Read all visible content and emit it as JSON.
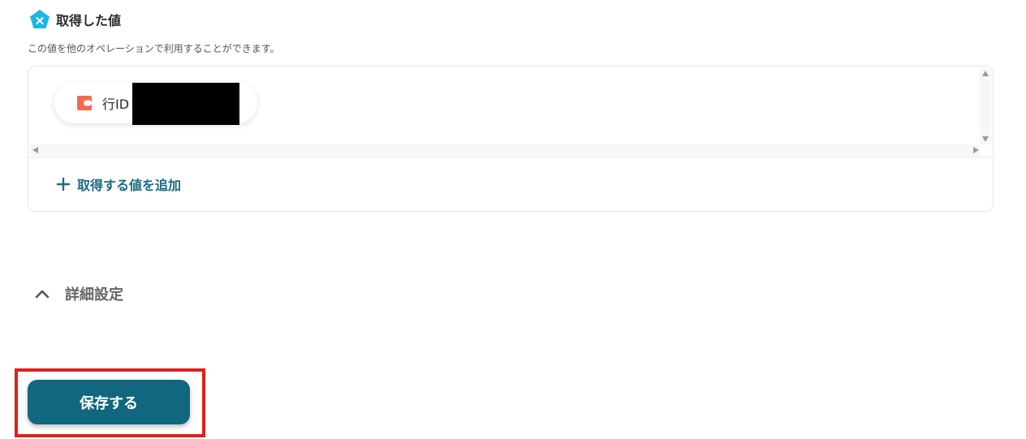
{
  "section": {
    "title": "取得した値",
    "description": "この値を他のオペレーションで利用することができます。",
    "icon": "x-pentagon-icon",
    "icon_color": "#1ab6e8"
  },
  "values": {
    "chips": [
      {
        "label": "行ID",
        "icon": "app-logo-icon",
        "icon_color": "#f26a4f"
      }
    ],
    "add_label": "取得する値を追加"
  },
  "advanced": {
    "label": "詳細設定"
  },
  "actions": {
    "save_label": "保存する"
  },
  "colors": {
    "accent": "#11677f",
    "highlight": "#e0201b"
  }
}
